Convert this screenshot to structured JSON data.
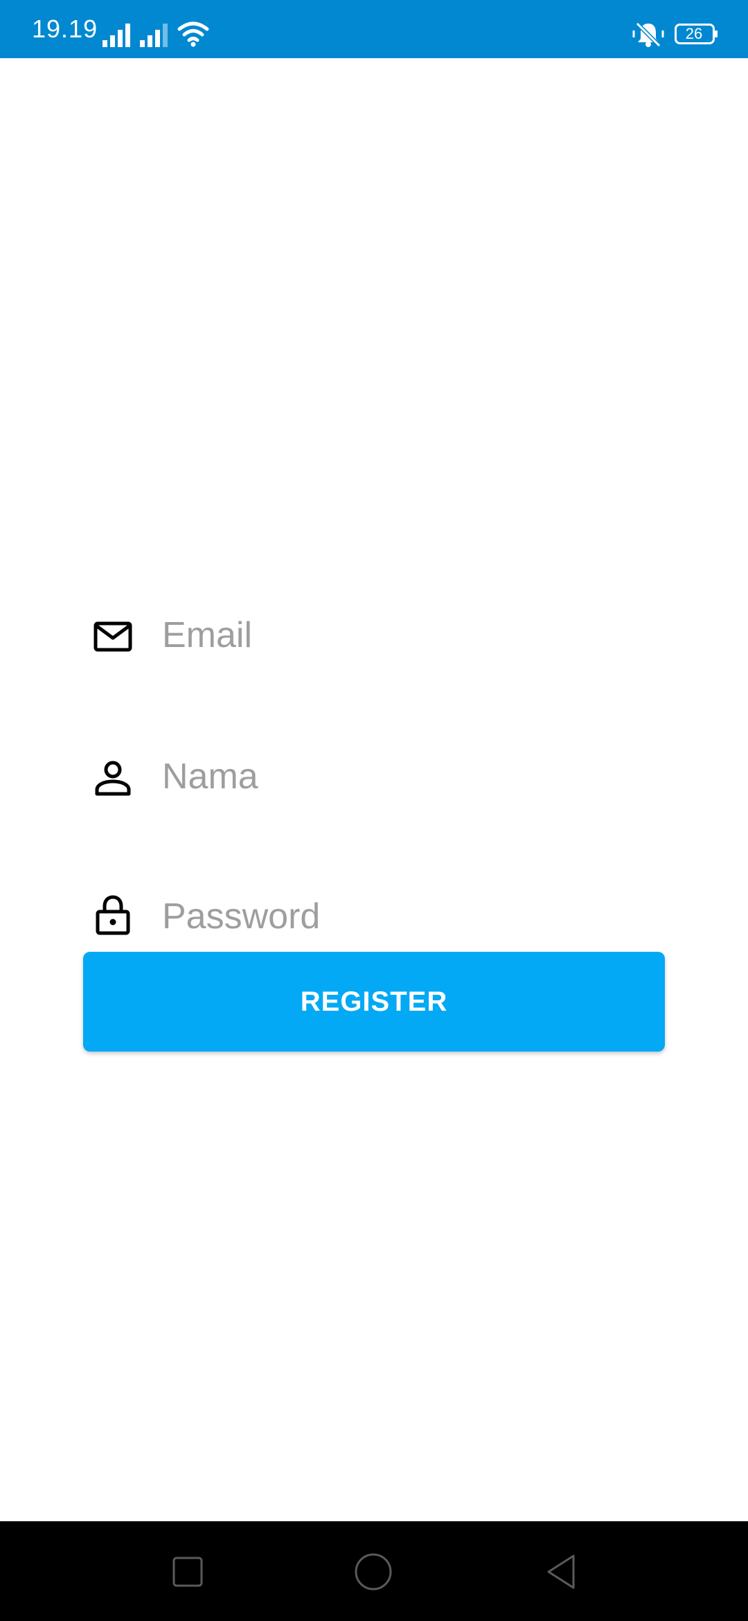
{
  "status_bar": {
    "time": "19.19",
    "battery_level": "26",
    "background_color": "#0288d1",
    "icons": [
      "signal-icon",
      "signal-icon",
      "wifi-icon",
      "vibrate-icon",
      "battery-icon"
    ]
  },
  "form": {
    "email": {
      "placeholder": "Email",
      "value": "",
      "icon": "mail-icon"
    },
    "name": {
      "placeholder": "Nama",
      "value": "",
      "icon": "person-icon"
    },
    "password": {
      "placeholder": "Password",
      "value": "",
      "icon": "lock-icon"
    },
    "register_label": "REGISTER",
    "register_color": "#03a9f4"
  },
  "nav_bar": {
    "buttons": [
      "recents-icon",
      "home-icon",
      "back-icon"
    ]
  }
}
